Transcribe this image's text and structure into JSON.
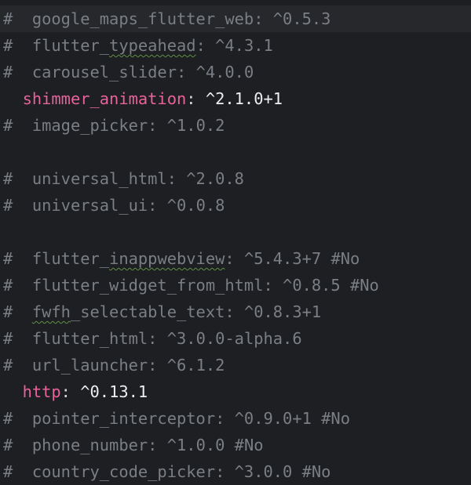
{
  "lines": [
    {
      "type": "comment",
      "name": "google_maps_flutter_web",
      "version": "^0.5.3",
      "current": true
    },
    {
      "type": "comment",
      "name": "flutter_typeahead",
      "version": "^4.3.1",
      "squiggle": "typeahead",
      "prefix": "flutter_"
    },
    {
      "type": "comment",
      "name": "carousel_slider",
      "version": "^4.0.0"
    },
    {
      "type": "active",
      "name": "shimmer_animation",
      "version": "^2.1.0+1"
    },
    {
      "type": "comment",
      "name": "image_picker",
      "version": "^1.0.2"
    },
    {
      "type": "blank"
    },
    {
      "type": "comment",
      "name": "universal_html",
      "version": "^2.0.8"
    },
    {
      "type": "comment",
      "name": "universal_ui",
      "version": "^0.0.8"
    },
    {
      "type": "blank"
    },
    {
      "type": "comment",
      "name": "flutter_inappwebview",
      "version": "^5.4.3+7 #No",
      "squiggle": "inappwebview",
      "prefix": "flutter_"
    },
    {
      "type": "comment",
      "name": "flutter_widget_from_html",
      "version": "^0.8.5 #No"
    },
    {
      "type": "comment",
      "name": "fwfh_selectable_text",
      "version": "^0.8.3+1",
      "squiggle": "fwfh",
      "prefix": "",
      "rest": "_selectable_text"
    },
    {
      "type": "comment",
      "name": "flutter_html",
      "version": "^3.0.0-alpha.6"
    },
    {
      "type": "comment",
      "name": "url_launcher",
      "version": "^6.1.2"
    },
    {
      "type": "active",
      "name": "http",
      "version": "^0.13.1"
    },
    {
      "type": "comment",
      "name": "pointer_interceptor",
      "version": "^0.9.0+1 #No"
    },
    {
      "type": "comment",
      "name": "phone_number",
      "version": "^1.0.0 #No"
    },
    {
      "type": "comment",
      "name": "country_code_picker",
      "version": "^3.0.0 #No"
    }
  ]
}
